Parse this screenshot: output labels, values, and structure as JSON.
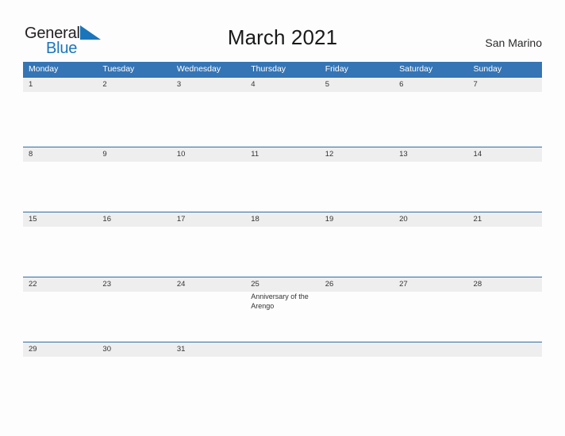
{
  "brand": {
    "word_general": "General",
    "word_blue": "Blue",
    "flag_icon": "blue-triangle-flag-icon",
    "accent_color": "#1b75bb"
  },
  "header": {
    "title": "March 2021",
    "country": "San Marino"
  },
  "theme": {
    "header_blue": "#3575b5",
    "row_band": "#eeeeee",
    "rule_blue": "#2e6da4",
    "page_background": "#fdfdfd"
  },
  "calendar": {
    "month": "March",
    "year": "2021",
    "weekday_headers": [
      "Monday",
      "Tuesday",
      "Wednesday",
      "Thursday",
      "Friday",
      "Saturday",
      "Sunday"
    ],
    "weeks": [
      {
        "days": [
          {
            "num": "1",
            "event": ""
          },
          {
            "num": "2",
            "event": ""
          },
          {
            "num": "3",
            "event": ""
          },
          {
            "num": "4",
            "event": ""
          },
          {
            "num": "5",
            "event": ""
          },
          {
            "num": "6",
            "event": ""
          },
          {
            "num": "7",
            "event": ""
          }
        ]
      },
      {
        "days": [
          {
            "num": "8",
            "event": ""
          },
          {
            "num": "9",
            "event": ""
          },
          {
            "num": "10",
            "event": ""
          },
          {
            "num": "11",
            "event": ""
          },
          {
            "num": "12",
            "event": ""
          },
          {
            "num": "13",
            "event": ""
          },
          {
            "num": "14",
            "event": ""
          }
        ]
      },
      {
        "days": [
          {
            "num": "15",
            "event": ""
          },
          {
            "num": "16",
            "event": ""
          },
          {
            "num": "17",
            "event": ""
          },
          {
            "num": "18",
            "event": ""
          },
          {
            "num": "19",
            "event": ""
          },
          {
            "num": "20",
            "event": ""
          },
          {
            "num": "21",
            "event": ""
          }
        ]
      },
      {
        "days": [
          {
            "num": "22",
            "event": ""
          },
          {
            "num": "23",
            "event": ""
          },
          {
            "num": "24",
            "event": ""
          },
          {
            "num": "25",
            "event": "Anniversary of the Arengo"
          },
          {
            "num": "26",
            "event": ""
          },
          {
            "num": "27",
            "event": ""
          },
          {
            "num": "28",
            "event": ""
          }
        ]
      },
      {
        "days": [
          {
            "num": "29",
            "event": ""
          },
          {
            "num": "30",
            "event": ""
          },
          {
            "num": "31",
            "event": ""
          },
          {
            "num": "",
            "event": ""
          },
          {
            "num": "",
            "event": ""
          },
          {
            "num": "",
            "event": ""
          },
          {
            "num": "",
            "event": ""
          }
        ]
      }
    ]
  }
}
